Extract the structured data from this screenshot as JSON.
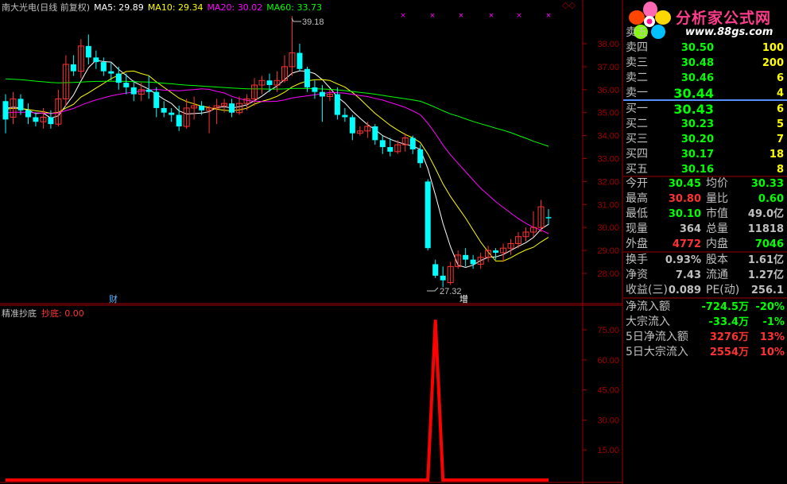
{
  "header": {
    "stock_name": "南大光电(日线 前复权)",
    "ma5": "MA5: 29.89",
    "ma10": "MA10: 29.34",
    "ma20": "MA20: 30.02",
    "ma60": "MA60: 33.73",
    "window_icons": "◇◇"
  },
  "indicator": {
    "name": "精准抄底",
    "value_label": "抄底: 0.00"
  },
  "annotations": {
    "high_label": "39.18",
    "low_label": "27.32",
    "cai_label": "财",
    "zeng_label": "增"
  },
  "logo": {
    "title": "分析家公式网",
    "url": "www.88gs.com"
  },
  "colors": {
    "up": "#ff3232",
    "down": "#00ffff",
    "ma5": "#ffffff",
    "ma10": "#ffff00",
    "ma20": "#ff00ff",
    "ma60": "#00ff00",
    "axis": "#a00000",
    "indicator": "#ff0000"
  },
  "chart_data": [
    {
      "type": "candlestick",
      "y_ticks": [
        "38.00",
        "37.00",
        "36.00",
        "35.00",
        "34.00",
        "33.00",
        "32.00",
        "31.00",
        "30.00",
        "29.00",
        "28.00"
      ],
      "ylim": [
        27.0,
        39.6
      ],
      "ohlc": [
        [
          35.5,
          35.8,
          34.1,
          34.7
        ],
        [
          34.8,
          35.9,
          34.5,
          35.6
        ],
        [
          35.6,
          35.8,
          34.9,
          35.1
        ],
        [
          35.1,
          35.4,
          34.5,
          34.8
        ],
        [
          34.8,
          35.0,
          34.4,
          34.6
        ],
        [
          34.6,
          35.2,
          34.3,
          34.8
        ],
        [
          34.8,
          35.1,
          34.3,
          34.5
        ],
        [
          34.5,
          36.0,
          34.4,
          35.6
        ],
        [
          35.6,
          37.5,
          35.3,
          37.1
        ],
        [
          37.1,
          37.5,
          36.6,
          36.8
        ],
        [
          36.8,
          38.2,
          36.5,
          37.9
        ],
        [
          37.9,
          38.4,
          37.1,
          37.4
        ],
        [
          37.4,
          37.7,
          36.9,
          37.2
        ],
        [
          37.2,
          37.4,
          36.6,
          36.8
        ],
        [
          36.8,
          37.2,
          36.4,
          36.7
        ],
        [
          36.7,
          37.0,
          36.0,
          36.3
        ],
        [
          36.3,
          36.7,
          35.8,
          36.1
        ],
        [
          36.1,
          36.4,
          35.5,
          35.8
        ],
        [
          35.8,
          36.3,
          35.5,
          36.0
        ],
        [
          36.0,
          36.6,
          35.6,
          35.9
        ],
        [
          35.9,
          36.1,
          34.8,
          35.2
        ],
        [
          35.2,
          35.5,
          34.8,
          35.0
        ],
        [
          35.0,
          35.2,
          34.6,
          34.9
        ],
        [
          34.9,
          35.3,
          34.2,
          34.4
        ],
        [
          34.4,
          35.6,
          34.3,
          35.2
        ],
        [
          35.2,
          35.7,
          34.7,
          35.3
        ],
        [
          35.3,
          35.5,
          34.9,
          35.1
        ],
        [
          35.1,
          35.3,
          34.1,
          35.2
        ],
        [
          35.2,
          35.6,
          34.5,
          35.3
        ],
        [
          35.3,
          35.6,
          35.0,
          35.4
        ],
        [
          35.4,
          35.6,
          34.8,
          35.0
        ],
        [
          35.0,
          35.7,
          34.9,
          35.4
        ],
        [
          35.4,
          35.8,
          35.1,
          35.6
        ],
        [
          35.6,
          36.5,
          35.3,
          36.2
        ],
        [
          36.2,
          36.6,
          35.8,
          36.4
        ],
        [
          36.4,
          36.7,
          35.9,
          36.2
        ],
        [
          36.2,
          36.8,
          35.9,
          36.4
        ],
        [
          36.4,
          37.5,
          36.3,
          37.0
        ],
        [
          37.0,
          39.2,
          36.6,
          37.6
        ],
        [
          37.6,
          38.0,
          36.8,
          36.9
        ],
        [
          36.9,
          37.0,
          35.9,
          36.1
        ],
        [
          36.1,
          36.4,
          35.6,
          35.9
        ],
        [
          35.9,
          36.2,
          34.6,
          35.7
        ],
        [
          35.7,
          36.0,
          35.5,
          35.8
        ],
        [
          35.8,
          36.1,
          34.7,
          34.9
        ],
        [
          34.9,
          35.2,
          34.6,
          34.8
        ],
        [
          34.8,
          34.9,
          33.8,
          34.1
        ],
        [
          34.1,
          34.4,
          34.0,
          34.2
        ],
        [
          34.2,
          34.6,
          33.9,
          34.4
        ],
        [
          34.4,
          34.5,
          33.6,
          33.8
        ],
        [
          33.8,
          34.0,
          33.2,
          33.5
        ],
        [
          33.5,
          33.9,
          33.1,
          33.3
        ],
        [
          33.3,
          33.8,
          33.2,
          33.6
        ],
        [
          33.6,
          34.1,
          33.3,
          33.9
        ],
        [
          33.9,
          34.0,
          33.2,
          33.4
        ],
        [
          33.4,
          33.6,
          32.6,
          32.8
        ],
        [
          32.0,
          32.1,
          29.0,
          29.1
        ],
        [
          28.4,
          28.6,
          27.8,
          27.9
        ],
        [
          27.9,
          28.3,
          27.4,
          27.7
        ],
        [
          27.6,
          28.5,
          27.5,
          28.3
        ],
        [
          28.3,
          29.0,
          28.2,
          28.8
        ],
        [
          28.8,
          29.1,
          28.3,
          28.6
        ],
        [
          28.6,
          28.8,
          28.2,
          28.4
        ],
        [
          28.4,
          28.9,
          28.2,
          28.7
        ],
        [
          28.7,
          29.2,
          28.5,
          29.0
        ],
        [
          29.0,
          29.1,
          28.6,
          28.9
        ],
        [
          28.9,
          29.3,
          28.5,
          29.1
        ],
        [
          29.1,
          29.5,
          28.8,
          29.3
        ],
        [
          29.3,
          29.8,
          29.1,
          29.6
        ],
        [
          29.6,
          30.0,
          29.4,
          29.8
        ],
        [
          29.8,
          30.7,
          29.6,
          30.0
        ],
        [
          30.0,
          31.2,
          29.8,
          30.9
        ],
        [
          30.45,
          30.8,
          30.1,
          30.4
        ]
      ],
      "ma5_ref": "MA5 29.89",
      "ma10_ref": "MA10 29.34",
      "ma20_ref": "MA20 30.02",
      "ma60_ref": "MA60 33.73"
    },
    {
      "type": "line",
      "name": "抄底",
      "y_ticks": [
        "75.00",
        "60.00",
        "45.00",
        "30.00",
        "15.00"
      ],
      "ylim": [
        0,
        90
      ],
      "values": [
        0,
        0,
        0,
        0,
        0,
        0,
        0,
        0,
        0,
        0,
        0,
        0,
        0,
        0,
        0,
        0,
        0,
        0,
        0,
        0,
        0,
        0,
        0,
        0,
        0,
        0,
        0,
        0,
        0,
        0,
        0,
        0,
        0,
        0,
        0,
        0,
        0,
        0,
        0,
        0,
        0,
        0,
        0,
        0,
        0,
        0,
        0,
        0,
        0,
        0,
        0,
        0,
        0,
        0,
        0,
        0,
        0,
        80,
        0,
        0,
        0,
        0,
        0,
        0,
        0,
        0,
        0,
        0,
        0,
        0,
        0,
        0,
        0
      ]
    }
  ],
  "panel": {
    "sell": [
      {
        "label": "卖五",
        "price": "",
        "vol": ""
      },
      {
        "label": "卖四",
        "price": "30.50",
        "vol": "100"
      },
      {
        "label": "卖三",
        "price": "30.48",
        "vol": "200"
      },
      {
        "label": "卖二",
        "price": "30.46",
        "vol": "6"
      },
      {
        "label": "卖一",
        "price": "30.44",
        "vol": "4"
      }
    ],
    "buy": [
      {
        "label": "买一",
        "price": "30.43",
        "vol": "6"
      },
      {
        "label": "买二",
        "price": "30.23",
        "vol": "5"
      },
      {
        "label": "买三",
        "price": "30.20",
        "vol": "7"
      },
      {
        "label": "买四",
        "price": "30.17",
        "vol": "18"
      },
      {
        "label": "买五",
        "price": "30.16",
        "vol": "8"
      }
    ],
    "quote": [
      {
        "l1": "今开",
        "v1": "30.45",
        "c1": "#00ff00",
        "l2": "均价",
        "v2": "30.33",
        "c2": "#00ff00"
      },
      {
        "l1": "最高",
        "v1": "30.80",
        "c1": "#ff3232",
        "l2": "量比",
        "v2": "0.60",
        "c2": "#00ff00"
      },
      {
        "l1": "最低",
        "v1": "30.10",
        "c1": "#00ff00",
        "l2": "市值",
        "v2": "49.0亿",
        "c2": "#c0c0c0"
      },
      {
        "l1": "现量",
        "v1": "364",
        "c1": "#c0c0c0",
        "l2": "总量",
        "v2": "11818",
        "c2": "#c0c0c0"
      },
      {
        "l1": "外盘",
        "v1": "4772",
        "c1": "#ff3232",
        "l2": "内盘",
        "v2": "7046",
        "c2": "#00ff00"
      }
    ],
    "quote2": [
      {
        "l1": "换手",
        "v1": "0.93%",
        "c1": "#c0c0c0",
        "l2": "股本",
        "v2": "1.61亿",
        "c2": "#c0c0c0"
      },
      {
        "l1": "净资",
        "v1": "7.43",
        "c1": "#c0c0c0",
        "l2": "流通",
        "v2": "1.27亿",
        "c2": "#c0c0c0"
      },
      {
        "l1": "收益(三)",
        "v1": "0.089",
        "c1": "#c0c0c0",
        "l2": "PE(动)",
        "v2": "256.1",
        "c2": "#c0c0c0"
      }
    ],
    "flows": [
      {
        "label": "净流入额",
        "value": "-724.5万",
        "pct": "-20%",
        "color": "#00ff00"
      },
      {
        "label": "大宗流入",
        "value": "-33.4万",
        "pct": "-1%",
        "color": "#00ff00"
      },
      {
        "label": "5日净流入额",
        "value": "3276万",
        "pct": "13%",
        "color": "#ff3232"
      },
      {
        "label": "5日大宗流入",
        "value": "2554万",
        "pct": "10%",
        "color": "#ff3232"
      }
    ]
  }
}
